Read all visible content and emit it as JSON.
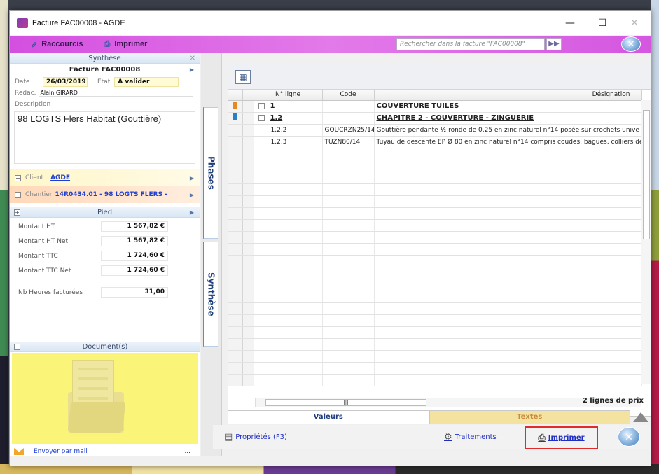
{
  "window": {
    "title": "Facture FAC00008 - AGDE",
    "minimize": "—",
    "maximize": "☐",
    "close": "✕"
  },
  "toolbar": {
    "raccourcis": "Raccourcis",
    "imprimer": "Imprimer",
    "search_placeholder": "Rechercher dans la facture \"FAC00008\""
  },
  "synthese": {
    "header": "Synthèse",
    "facture_title": "Facture FAC00008",
    "date_label": "Date",
    "date_value": "26/03/2019",
    "etat_label": "Etat",
    "etat_value": "A valider",
    "redac_label": "Redac.",
    "redac_value": "Alain GIRARD",
    "description_label": "Description",
    "description_value": "98 LOGTS Flers Habitat (Gouttière)",
    "client_label": "Client",
    "client_value": "AGDE",
    "chantier_label": "Chantier",
    "chantier_value": "14R0434.01 - 98 LOGTS FLERS -"
  },
  "pied": {
    "header": "Pied",
    "rows": [
      {
        "label": "Montant HT",
        "value": "1 567,82 €"
      },
      {
        "label": "Montant HT Net",
        "value": "1 567,82 €"
      },
      {
        "label": "Montant TTC",
        "value": "1 724,60 €"
      },
      {
        "label": "Montant TTC Net",
        "value": "1 724,60 €"
      }
    ],
    "heures_label": "Nb Heures facturées",
    "heures_value": "31,00"
  },
  "documents": {
    "header": "Document(s)",
    "mail": "Envoyer par mail",
    "more": "..."
  },
  "vtabs": {
    "phases": "Phases",
    "synthese": "Synthèse"
  },
  "grid": {
    "headers": {
      "ligne": "N° ligne",
      "code": "Code",
      "designation": "Désignation"
    },
    "rows": [
      {
        "ligne": "1",
        "code": "",
        "designation": "COUVERTURE TUILES",
        "type": "chapter",
        "marker": "orange"
      },
      {
        "ligne": "1.2",
        "code": "",
        "designation": "CHAPITRE 2 - COUVERTURE - ZINGUERIE",
        "type": "chapter",
        "marker": "blue"
      },
      {
        "ligne": "1.2.2",
        "code": "GOUCRZN25/14",
        "designation": "Gouttière pendante ½ ronde de 0.25 en zinc naturel n°14 posée sur crochets unive",
        "type": "item",
        "marker": ""
      },
      {
        "ligne": "1.2.3",
        "code": "TUZN80/14",
        "designation": "Tuyau de descente EP Ø 80 en zinc naturel n°14 compris coudes, bagues, colliers de",
        "type": "item",
        "marker": ""
      }
    ],
    "count": "2 lignes de prix"
  },
  "bottom_tabs": {
    "valeurs": "Valeurs",
    "textes": "Textes"
  },
  "footer": {
    "proprietes": "Propriétés (F3)",
    "traitements": "Traitements",
    "imprimer": "Imprimer"
  },
  "colors": {
    "toolbar": "#d957e3",
    "accent_blue": "#1f3fd0",
    "highlight_red": "#e12b2b"
  }
}
